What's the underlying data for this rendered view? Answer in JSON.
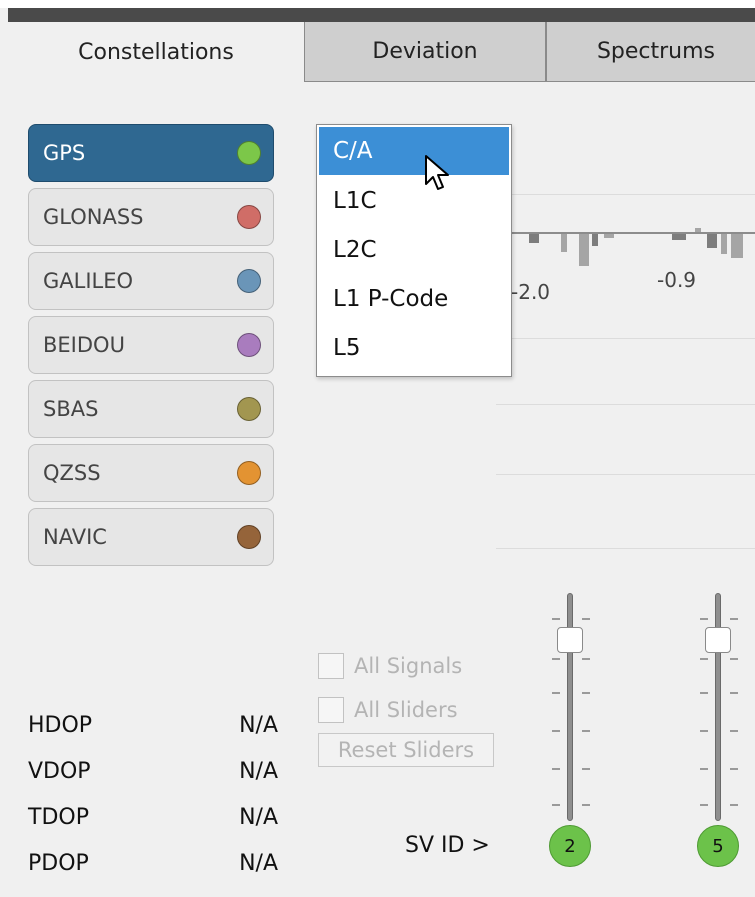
{
  "tabs": [
    {
      "label": "Constellations"
    },
    {
      "label": "Deviation"
    },
    {
      "label": "Spectrums"
    }
  ],
  "constellations": [
    {
      "label": "GPS",
      "color": "#7cc749"
    },
    {
      "label": "GLONASS",
      "color": "#d06d67"
    },
    {
      "label": "GALILEO",
      "color": "#6a95b8"
    },
    {
      "label": "BEIDOU",
      "color": "#a97cbe"
    },
    {
      "label": "SBAS",
      "color": "#a29650"
    },
    {
      "label": "QZSS",
      "color": "#e39332"
    },
    {
      "label": "NAVIC",
      "color": "#95643a"
    }
  ],
  "selected_constellation": "GPS",
  "signal_dropdown": {
    "options": [
      "C/A",
      "L1C",
      "L2C",
      "L1 P-Code",
      "L5"
    ],
    "selected": "C/A"
  },
  "chart": {
    "tick_labels": [
      "-2.0",
      "-0.9"
    ]
  },
  "controls": {
    "all_signals_label": "All Signals",
    "all_sliders_label": "All Sliders",
    "reset_sliders_label": "Reset Sliders"
  },
  "dop": [
    {
      "label": "HDOP",
      "value": "N/A"
    },
    {
      "label": "VDOP",
      "value": "N/A"
    },
    {
      "label": "TDOP",
      "value": "N/A"
    },
    {
      "label": "PDOP",
      "value": "N/A"
    }
  ],
  "sv": {
    "label": "SV ID >",
    "ids": [
      "2",
      "5"
    ],
    "badge_color": "#6cc24a"
  },
  "icons": [
    "pointer-cursor-icon"
  ]
}
